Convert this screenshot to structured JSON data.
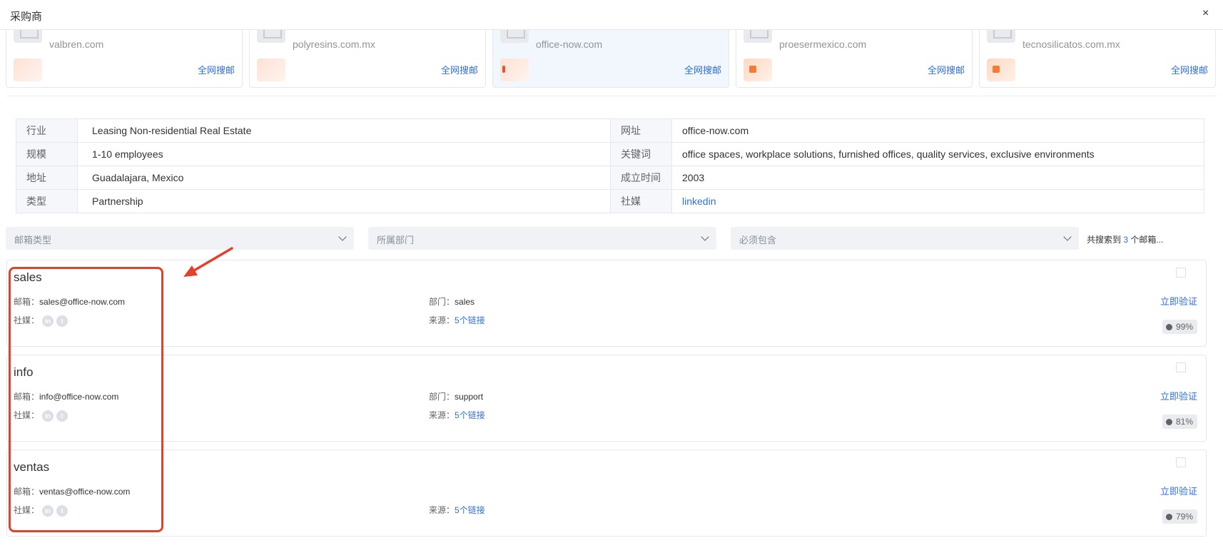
{
  "window": {
    "title": "采购商",
    "close_glyph": "×"
  },
  "companies": [
    {
      "name": "valbren.com",
      "search_label": "全网搜邮",
      "active": false
    },
    {
      "name": "polyresins.com.mx",
      "search_label": "全网搜邮",
      "active": false
    },
    {
      "name": "office-now.com",
      "search_label": "全网搜邮",
      "active": true
    },
    {
      "name": "proesermexico.com",
      "search_label": "全网搜邮",
      "active": false
    },
    {
      "name": "tecnosilicatos.com.mx",
      "search_label": "全网搜邮",
      "active": false
    }
  ],
  "info": {
    "rows": [
      {
        "l1": "行业",
        "v1": "Leasing Non-residential Real Estate",
        "l2": "网址",
        "v2": "office-now.com"
      },
      {
        "l1": "规模",
        "v1": "1-10 employees",
        "l2": "关键词",
        "v2": "office spaces, workplace solutions, furnished offices, quality services, exclusive environments"
      },
      {
        "l1": "地址",
        "v1": "Guadalajara, Mexico",
        "l2": "成立时间",
        "v2": "2003"
      },
      {
        "l1": "类型",
        "v1": "Partnership",
        "l2": "社媒",
        "v2": "linkedin"
      }
    ]
  },
  "filters": {
    "mailbox_type": "邮箱类型",
    "department": "所属部门",
    "must_include": "必须包含",
    "summary_prefix": "共搜索到",
    "summary_count": "3",
    "summary_suffix": "个邮箱..."
  },
  "emails": [
    {
      "title": "sales",
      "email_label": "邮箱：",
      "email": "sales@office-now.com",
      "social_label": "社媒：",
      "dept_label": "部门：",
      "dept": "sales",
      "source_label": "来源：",
      "source": "5个链接",
      "verify": "立即验证",
      "score": "99%"
    },
    {
      "title": "info",
      "email_label": "邮箱：",
      "email": "info@office-now.com",
      "social_label": "社媒：",
      "dept_label": "部门：",
      "dept": "support",
      "source_label": "来源：",
      "source": "5个链接",
      "verify": "立即验证",
      "score": "81%"
    },
    {
      "title": "ventas",
      "email_label": "邮箱：",
      "email": "ventas@office-now.com",
      "social_label": "社媒：",
      "dept_label": "",
      "dept": "",
      "source_label": "来源：",
      "source": "5个链接",
      "verify": "立即验证",
      "score": "79%"
    }
  ],
  "icons": {
    "linkedin": "linkedin-icon",
    "twitter": "twitter-icon"
  },
  "colors": {
    "link": "#2f6fd9",
    "annotation": "#e5412a",
    "active_card": "#f2f6fd"
  }
}
